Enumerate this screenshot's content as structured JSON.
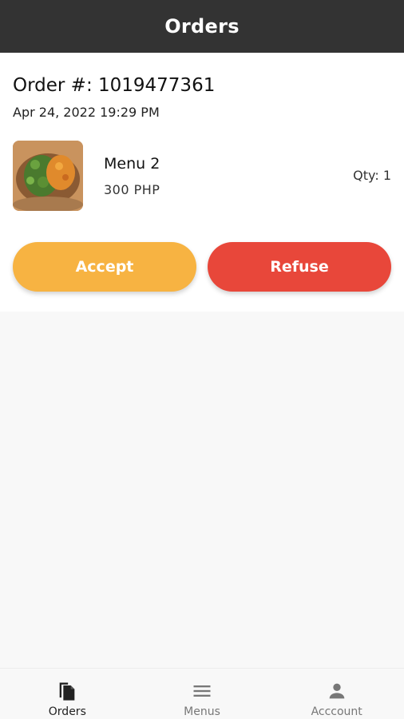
{
  "header": {
    "title": "Orders"
  },
  "order": {
    "number_label": "Order #: 1019477361",
    "date": "Apr 24, 2022 19:29 PM",
    "item": {
      "name": "Menu 2",
      "price": "300 PHP",
      "qty": "Qty: 1",
      "image_icon": "food-photo"
    },
    "accept_label": "Accept",
    "refuse_label": "Refuse"
  },
  "nav": {
    "items": [
      {
        "label": "Orders",
        "icon": "document-copy-icon",
        "active": true
      },
      {
        "label": "Menus",
        "icon": "menu-lines-icon",
        "active": false
      },
      {
        "label": "Acccount",
        "icon": "person-icon",
        "active": false
      }
    ]
  },
  "colors": {
    "appbar": "#333333",
    "accept": "#f7b342",
    "refuse": "#e8473a",
    "nav_active": "#222222",
    "nav_inactive": "#777777"
  }
}
